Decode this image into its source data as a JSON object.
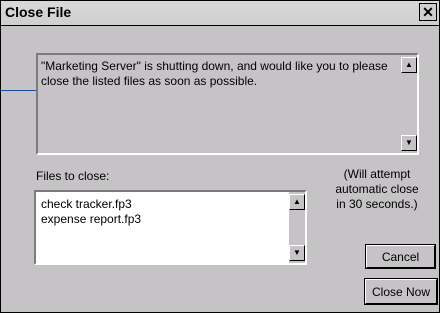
{
  "window": {
    "title": "Close File",
    "close_glyph": "✕"
  },
  "message": {
    "text": "\"Marketing Server\" is shutting down, and would like you to please close the listed files as soon as possible."
  },
  "files": {
    "label": "Files to close:",
    "items": [
      "check tracker.fp3",
      "expense report.fp3"
    ]
  },
  "note": {
    "line1": "(Will attempt",
    "line2": "automatic close",
    "line3": "in 30 seconds.)"
  },
  "buttons": {
    "cancel": "Cancel",
    "close_now": "Close Now"
  },
  "scroll": {
    "up_glyph": "▲",
    "down_glyph": "▼"
  }
}
